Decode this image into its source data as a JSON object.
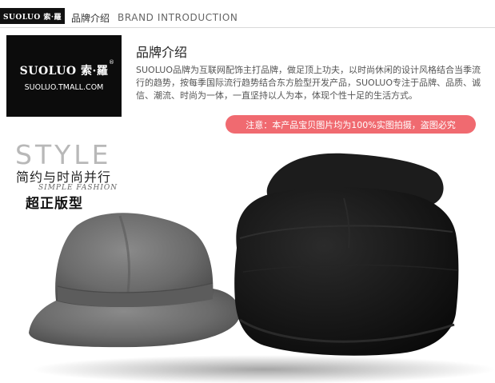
{
  "header": {
    "logo_text": "SUOLUO 索·羅",
    "title_cn": "品牌介绍",
    "title_en": "BRAND INTRODUCTION"
  },
  "brand_logo": {
    "name": "SUOLUO 索·羅",
    "registered": "®",
    "url": "SUOLUO.TMALL.COM"
  },
  "intro": {
    "title": "品牌介绍",
    "body": "SUOLUO品牌为互联网配饰主打品牌，做足顶上功夫，以时尚休闲的设计风格结合当季流行的趋势，按每季国际流行趋势结合东方脸型开发产品，SUOLUO专注于品牌、品质、诚信、潮流、时尚为一体，一直坚持以人为本，体现个性十足的生活方式。"
  },
  "notice": {
    "text": "注意：本产品宝贝图片均为100%实图拍摄，盗图必究"
  },
  "style_block": {
    "word": "STYLE",
    "subtitle_cn": "简约与时尚并行",
    "subtitle_en": "SIMPLE FASHION",
    "tag": "超正版型"
  },
  "colors": {
    "notice_bg": "#f06a70",
    "logo_bg": "#0c0c0c",
    "hat_grey": "#6f6f6f",
    "hat_black": "#151515"
  }
}
